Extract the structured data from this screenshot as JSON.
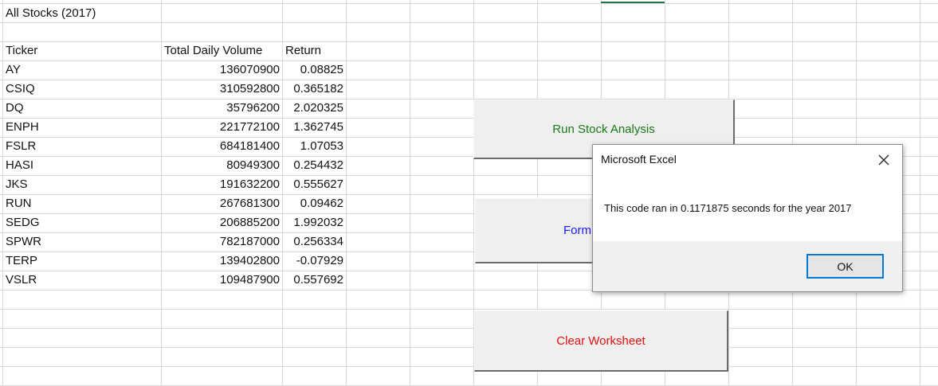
{
  "sheet": {
    "title": "All Stocks (2017)",
    "headers": {
      "ticker": "Ticker",
      "volume": "Total Daily Volume",
      "return": "Return"
    },
    "rows": [
      {
        "ticker": "AY",
        "volume": "136070900",
        "return": "0.08825"
      },
      {
        "ticker": "CSIQ",
        "volume": "310592800",
        "return": "0.365182"
      },
      {
        "ticker": "DQ",
        "volume": "35796200",
        "return": "2.020325"
      },
      {
        "ticker": "ENPH",
        "volume": "221772100",
        "return": "1.362745"
      },
      {
        "ticker": "FSLR",
        "volume": "684181400",
        "return": "1.07053"
      },
      {
        "ticker": "HASI",
        "volume": "80949300",
        "return": "0.254432"
      },
      {
        "ticker": "JKS",
        "volume": "191632200",
        "return": "0.555627"
      },
      {
        "ticker": "RUN",
        "volume": "267681300",
        "return": "0.09462"
      },
      {
        "ticker": "SEDG",
        "volume": "206885200",
        "return": "1.992032"
      },
      {
        "ticker": "SPWR",
        "volume": "782187000",
        "return": "0.256334"
      },
      {
        "ticker": "TERP",
        "volume": "139402800",
        "return": "-0.07929"
      },
      {
        "ticker": "VSLR",
        "volume": "109487900",
        "return": "0.557692"
      }
    ]
  },
  "buttons": {
    "run": {
      "label": "Run Stock Analysis",
      "color": "#1a7a1a"
    },
    "format": {
      "label": "Form",
      "color": "#1a1aff"
    },
    "clear": {
      "label": "Clear Worksheet",
      "color": "#e01010"
    }
  },
  "dialog": {
    "title": "Microsoft Excel",
    "close_icon": "close-icon",
    "message": "This code ran in 0.1171875 seconds for the year 2017",
    "ok_label": "OK",
    "ok_border_color": "#0078d7"
  },
  "colors": {
    "gridline": "#d9d9d9",
    "accent": "#217346"
  }
}
